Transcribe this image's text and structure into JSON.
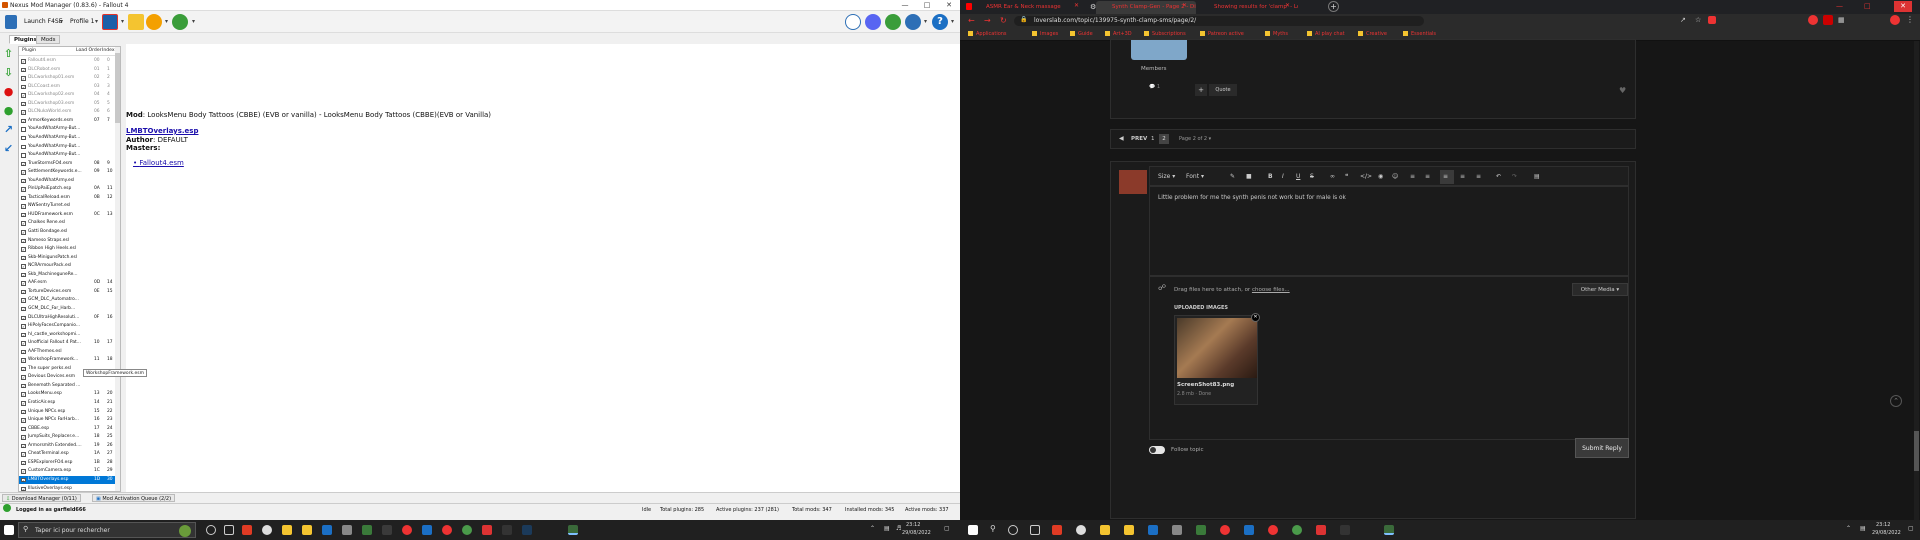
{
  "nmm": {
    "title": "Nexus Mod Manager (0.83.6) - Fallout 4",
    "toolbar": {
      "launch": "Launch F4SE",
      "profile": "Profile 1"
    },
    "tabs": [
      "Plugins",
      "Mods"
    ],
    "plugin_headers": {
      "plugin": "Plugin",
      "load_order": "Load Order",
      "index": "Index"
    },
    "plugins": [
      [
        "Fallout4.esm",
        "00",
        "0",
        1,
        1
      ],
      [
        "DLCRobot.esm",
        "01",
        "1",
        1,
        1
      ],
      [
        "DLCworkshop01.esm",
        "02",
        "2",
        1,
        1
      ],
      [
        "DLCCoast.esm",
        "03",
        "3",
        1,
        1
      ],
      [
        "DLCworkshop02.esm",
        "04",
        "4",
        1,
        1
      ],
      [
        "DLCworkshop03.esm",
        "05",
        "5",
        1,
        1
      ],
      [
        "DLCNukaWorld.esm",
        "06",
        "6",
        1,
        1
      ],
      [
        "ArmorKeywords.esm",
        "07",
        "7",
        1,
        0
      ],
      [
        "YouAndWhatArmy-But...",
        "",
        "",
        0,
        0
      ],
      [
        "YouAndWhatArmy-But...",
        "",
        "",
        0,
        0
      ],
      [
        "YouAndWhatArmy-But...",
        "",
        "",
        0,
        0
      ],
      [
        "YouAndWhatArmy-But...",
        "",
        "",
        0,
        0
      ],
      [
        "TrueStormsFO4.esm",
        "08",
        "9",
        1,
        0
      ],
      [
        "SettlementKeywords.e...",
        "09",
        "10",
        1,
        0
      ],
      [
        "YouAndWhatArmy.esl",
        "",
        "",
        1,
        0
      ],
      [
        "PinUpPaiEpatch.esp",
        "0A",
        "11",
        1,
        0
      ],
      [
        "TacticalReload.esm",
        "0B",
        "12",
        1,
        0
      ],
      [
        "NWSentryTurret.esl",
        "",
        "",
        1,
        0
      ],
      [
        "HUDFramework.esm",
        "0C",
        "13",
        1,
        0
      ],
      [
        "Chalkes Rene.esl",
        "",
        "",
        1,
        0
      ],
      [
        "Gatti Bondage.esl",
        "",
        "",
        1,
        0
      ],
      [
        "Nameso Straps.esl",
        "",
        "",
        1,
        0
      ],
      [
        "Ribbon High Heels.esl",
        "",
        "",
        1,
        0
      ],
      [
        "Skb-MinigunsPatch.esl",
        "",
        "",
        1,
        0
      ],
      [
        "NCRArmourPack.esl",
        "",
        "",
        1,
        0
      ],
      [
        "Skb_MachineguneRe...",
        "",
        "",
        1,
        0
      ],
      [
        "AAF.esm",
        "0D",
        "14",
        1,
        0
      ],
      [
        "TortureDevices.esm",
        "0E",
        "15",
        1,
        0
      ],
      [
        "GCM_DLC_Automatro...",
        "",
        "",
        1,
        0
      ],
      [
        "GCM_DLC_Far_Harb...",
        "",
        "",
        1,
        0
      ],
      [
        "DLCUltraHighResoluti...",
        "0F",
        "16",
        1,
        0
      ],
      [
        "HiPolyFacesCompanio...",
        "",
        "",
        1,
        0
      ],
      [
        "hl_castle_workshopmi...",
        "",
        "",
        1,
        0
      ],
      [
        "Unofficial Fallout 4 Pat...",
        "10",
        "17",
        1,
        0
      ],
      [
        "AAFThemes.esl",
        "",
        "",
        1,
        0
      ],
      [
        "WorkshopFramework...",
        "11",
        "18",
        1,
        0
      ],
      [
        "The super perks.esl",
        "",
        "",
        1,
        0
      ],
      [
        "Devious Devices.esm",
        "",
        "",
        1,
        0
      ],
      [
        "Benemoth Separated ...",
        "",
        "",
        1,
        0
      ],
      [
        "LooksMenu.esp",
        "13",
        "20",
        1,
        0
      ],
      [
        "EroticAir.esp",
        "14",
        "21",
        1,
        0
      ],
      [
        "Unique NPCs.esp",
        "15",
        "22",
        1,
        0
      ],
      [
        "Unique NPCs FarHarb...",
        "16",
        "23",
        1,
        0
      ],
      [
        "CBBE.esp",
        "17",
        "24",
        1,
        0
      ],
      [
        "JumpSuits_Replacer.e...",
        "18",
        "25",
        1,
        0
      ],
      [
        "Armorsmith Extended....",
        "19",
        "26",
        1,
        0
      ],
      [
        "CheatTerminal.esp",
        "1A",
        "27",
        1,
        0
      ],
      [
        "ESPExplorerFO4.esp",
        "1B",
        "28",
        1,
        0
      ],
      [
        "CustomCamera.esp",
        "1C",
        "29",
        1,
        0
      ],
      [
        "LMBTOverlays.esp",
        "1D",
        "30",
        1,
        0
      ],
      [
        "IllusiveOverlays.esp",
        "",
        "",
        1,
        0
      ]
    ],
    "selected_index": 49,
    "tooltip": "WorkshopFramework.esm",
    "details": {
      "mod_label": "Mod",
      "mod_value": ": LooksMenu Body Tattoos (CBBE) (EVB or vanilla) - LooksMenu Body Tattoos (CBBE)(EVB or Vanilla)",
      "file": "LMBTOverlays.esp",
      "author_label": "Author",
      "author_value": ": DEFAULT",
      "masters_label": "Masters",
      "masters": [
        "Fallout4.esm"
      ]
    },
    "bottom_tabs": [
      "Download Manager (0/11)",
      "Mod Activation Queue (2/2)"
    ],
    "status": {
      "login": "Logged in as garfield666",
      "idle": "Idle",
      "total_plugins": "Total plugins: 285",
      "active_plugins": "Active plugins:  237 (281)",
      "total_mods": "Total mods: 347",
      "installed_mods": "Installed mods: 345",
      "active_mods": "Active mods: 337"
    }
  },
  "taskbar_left": {
    "search": "Taper ici pour rechercher",
    "time": "23:12",
    "date": "29/08/2022"
  },
  "taskbar_right": {
    "time": "23:12",
    "date": "29/08/2022"
  },
  "browser": {
    "tabs": [
      "ASMR Ear & Neck massage",
      "Synth Clamp-Gen - Page 2 - Disc...",
      "Showing results for 'clamp' - Lo..."
    ],
    "url": "loverslab.com/topic/139975-synth-clamp-sms/page/2/",
    "bookmarks": [
      "Applications",
      "Images",
      "Guide",
      "Art+3D",
      "Subscriptions",
      "Patreon active",
      "Myths",
      "AI play chat",
      "Creative",
      "Essentials"
    ],
    "members_label": "Members",
    "quote": "Quote",
    "reply_count": "1",
    "prev": "PREV",
    "page1": "1",
    "page2": "2",
    "page_of": "Page 2 of 2",
    "editor": {
      "size": "Size",
      "font": "Font"
    },
    "message": "Little problem for me the synth penis not work but for male is ok",
    "drag_text": "Drag files here to attach, or ",
    "choose_files": "choose files...",
    "other_media": "Other Media",
    "uploaded_images": "UPLOADED IMAGES",
    "image_name": "ScreenShot83.png",
    "image_info": "2.8 mb · Done",
    "follow_topic": "Follow topic",
    "submit": "Submit Reply"
  }
}
